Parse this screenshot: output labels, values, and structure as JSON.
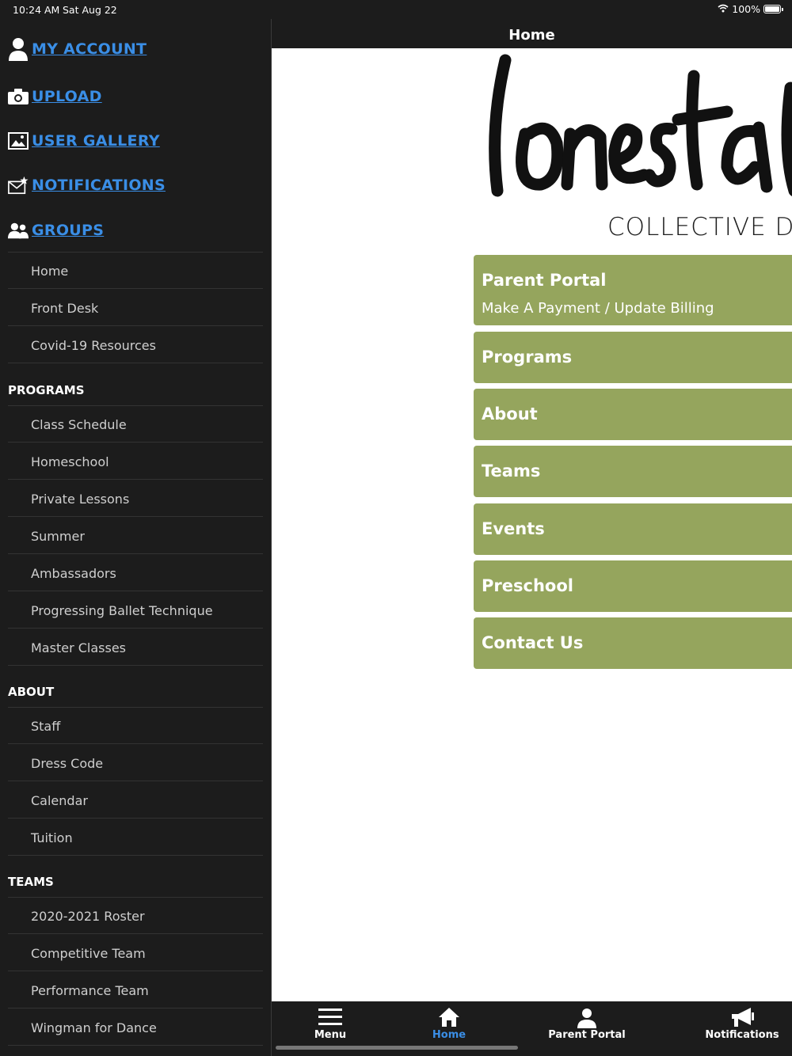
{
  "status_bar": {
    "time": "10:24 AM",
    "date": "Sat Aug 22",
    "battery": "100%"
  },
  "sidebar": {
    "account_links": [
      {
        "label": "MY ACCOUNT",
        "icon": "user-icon"
      },
      {
        "label": "UPLOAD",
        "icon": "camera-icon"
      },
      {
        "label": "USER GALLERY",
        "icon": "gallery-icon"
      },
      {
        "label": "NOTIFICATIONS",
        "icon": "mail-star-icon"
      },
      {
        "label": "GROUPS",
        "icon": "group-icon"
      }
    ],
    "groups_items": [
      "Home",
      "Front Desk",
      "Covid-19 Resources"
    ],
    "programs": {
      "header": "PROGRAMS",
      "items": [
        "Class Schedule",
        "Homeschool",
        "Private Lessons",
        "Summer",
        "Ambassadors",
        "Progressing Ballet Technique",
        "Master Classes"
      ]
    },
    "about": {
      "header": "ABOUT",
      "items": [
        "Staff",
        "Dress Code",
        "Calendar",
        "Tuition"
      ]
    },
    "teams": {
      "header": "TEAMS",
      "items": [
        "2020-2021 Roster",
        "Competitive Team",
        "Performance Team",
        "Wingman for Dance"
      ]
    }
  },
  "main": {
    "header_title": "Home",
    "logo": {
      "script": "lonesta",
      "subtitle": "COLLECTIVE DA"
    },
    "tiles": [
      {
        "title": "Parent Portal",
        "subtitle": "Make A Payment / Update Billing"
      },
      {
        "title": "Programs"
      },
      {
        "title": "About"
      },
      {
        "title": "Teams"
      },
      {
        "title": "Events"
      },
      {
        "title": "Preschool"
      },
      {
        "title": "Contact Us"
      }
    ],
    "tile_color": "#95a55d"
  },
  "tabbar": {
    "tabs": [
      {
        "label": "Menu",
        "icon": "menu-icon"
      },
      {
        "label": "Home",
        "icon": "home-icon",
        "active": true
      },
      {
        "label": "Parent Portal",
        "icon": "person-icon"
      },
      {
        "label": "Notifications",
        "icon": "megaphone-icon"
      }
    ],
    "active_color": "#3a8ee6"
  }
}
